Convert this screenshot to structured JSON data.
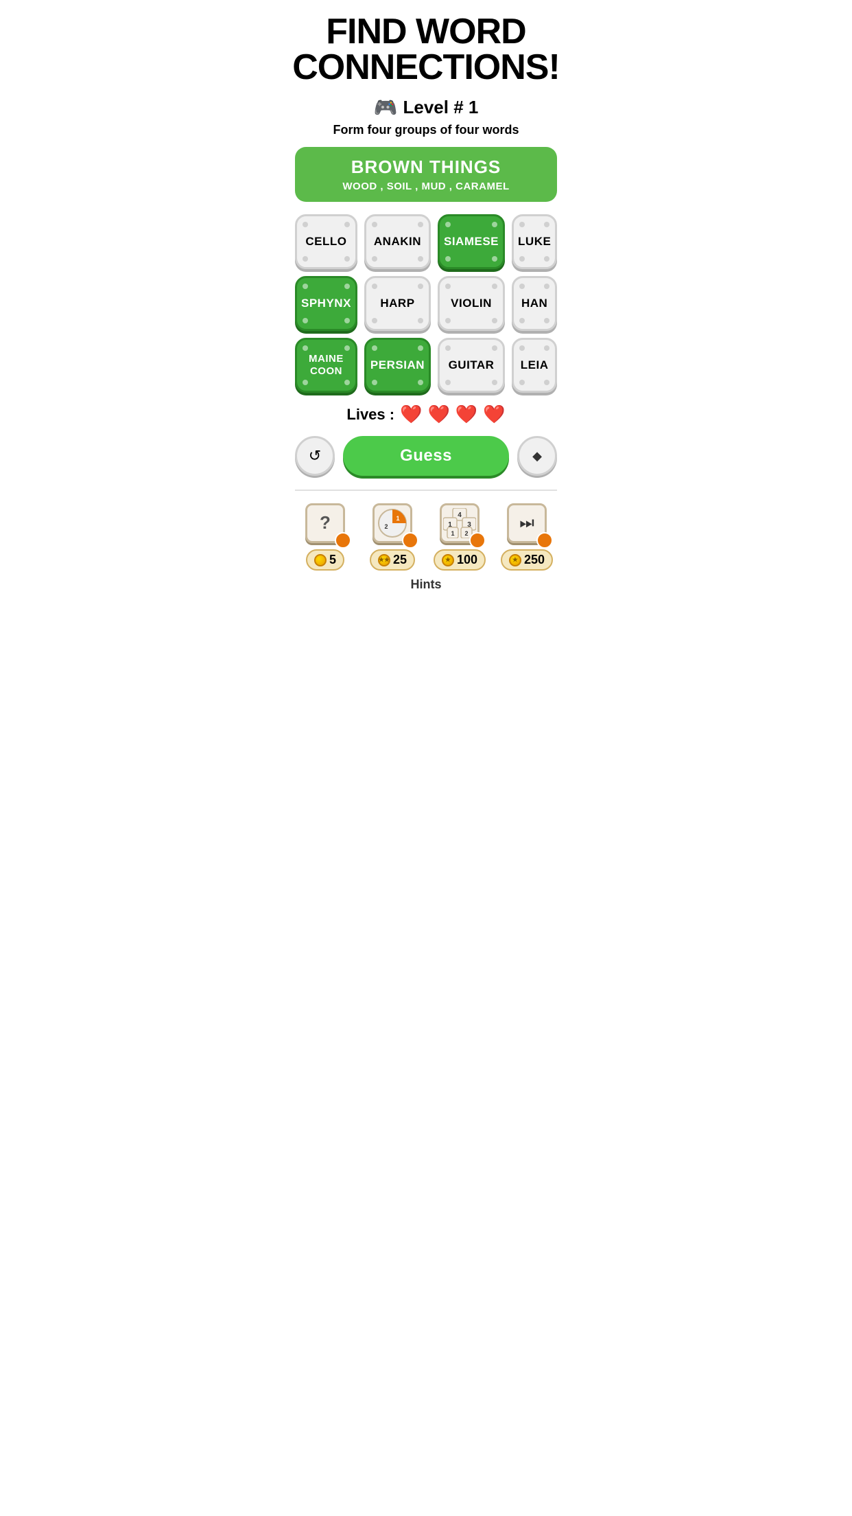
{
  "title": "FIND WORD\nCONNECTIONS!",
  "level": {
    "icon": "🎮",
    "label": "Level # 1"
  },
  "subtitle": "Form four groups of four words",
  "solved_group": {
    "title": "BROWN THINGS",
    "words": "WOOD , SOIL , MUD , CARAMEL"
  },
  "tiles": [
    {
      "word": "CELLO",
      "selected": false
    },
    {
      "word": "ANAKIN",
      "selected": false
    },
    {
      "word": "SIAMESE",
      "selected": true
    },
    {
      "word": "LUKE",
      "selected": false
    },
    {
      "word": "SPHYNX",
      "selected": true
    },
    {
      "word": "HARP",
      "selected": false
    },
    {
      "word": "VIOLIN",
      "selected": false
    },
    {
      "word": "HAN",
      "selected": false
    },
    {
      "word": "MAINE\nCOON",
      "selected": true
    },
    {
      "word": "PERSIAN",
      "selected": true
    },
    {
      "word": "GUITAR",
      "selected": false
    },
    {
      "word": "LEIA",
      "selected": false
    }
  ],
  "lives": {
    "label": "Lives :",
    "count": 4,
    "icon": "❤️"
  },
  "buttons": {
    "shuffle": "↺",
    "guess": "Guess",
    "erase": "◆"
  },
  "hints": [
    {
      "type": "question",
      "symbol": "?",
      "cost": "5"
    },
    {
      "type": "pie",
      "symbol": "1 2",
      "cost": "25"
    },
    {
      "type": "stack",
      "symbol": "1 4 3\n1 2",
      "cost": "100"
    },
    {
      "type": "play",
      "symbol": "▶|",
      "cost": "250"
    }
  ],
  "hints_label": "Hints"
}
